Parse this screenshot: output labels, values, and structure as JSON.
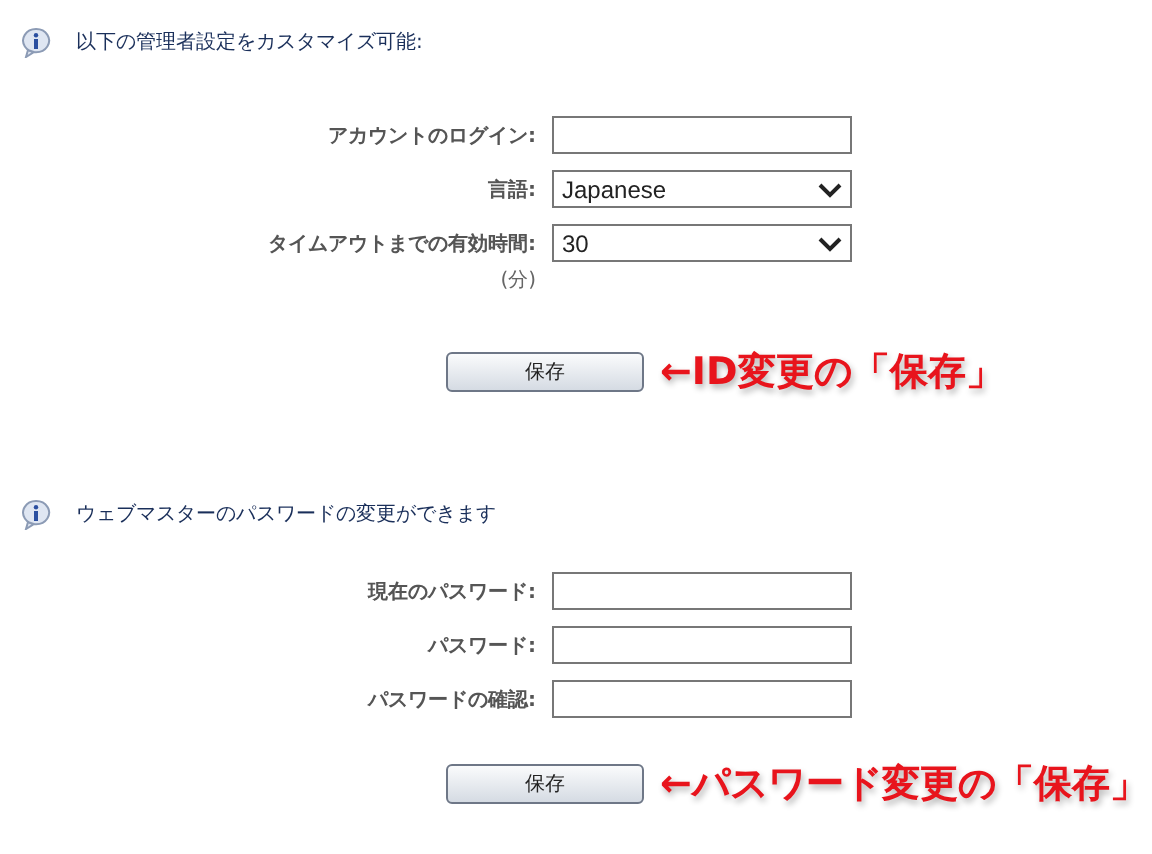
{
  "sections": [
    {
      "info": "以下の管理者設定をカスタマイズ可能:",
      "fields": [
        {
          "kind": "text",
          "label": "アカウントのログイン:"
        },
        {
          "kind": "select",
          "label": "言語:",
          "value": "Japanese"
        },
        {
          "kind": "select",
          "label": "タイムアウトまでの有効時間:",
          "sublabel": "(分)",
          "value": "30"
        }
      ],
      "button": "保存",
      "annotation": "←ID変更の「保存」"
    },
    {
      "info": "ウェブマスターのパスワードの変更ができます",
      "fields": [
        {
          "kind": "password",
          "label": "現在のパスワード:"
        },
        {
          "kind": "password",
          "label": "パスワード:"
        },
        {
          "kind": "password",
          "label": "パスワードの確認:"
        }
      ],
      "button": "保存",
      "annotation": "←パスワード変更の「保存」"
    }
  ]
}
